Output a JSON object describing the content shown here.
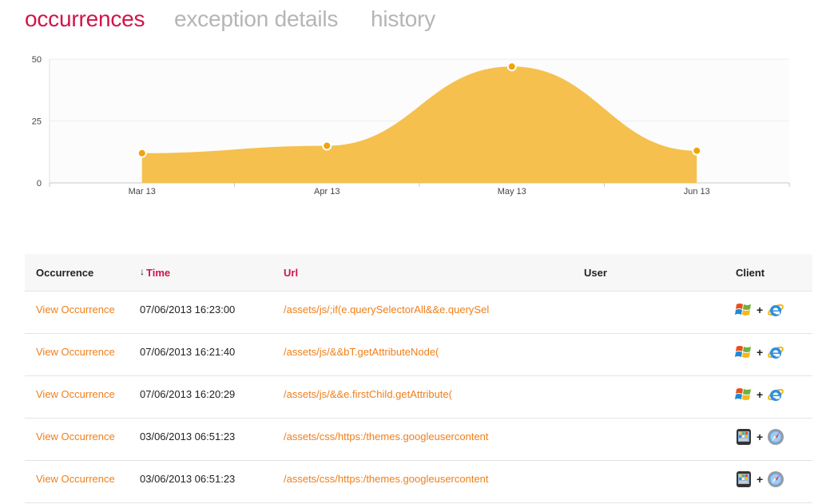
{
  "tabs": [
    {
      "label": "occurrences",
      "active": true
    },
    {
      "label": "exception details",
      "active": false
    },
    {
      "label": "history",
      "active": false
    }
  ],
  "chart_data": {
    "type": "area",
    "categories": [
      "Mar 13",
      "Apr 13",
      "May 13",
      "Jun 13"
    ],
    "values": [
      12,
      15,
      47,
      13
    ],
    "title": "",
    "xlabel": "",
    "ylabel": "",
    "ylim": [
      0,
      50
    ],
    "yticks": [
      0,
      25,
      50
    ],
    "grid": true,
    "fill_color": "#f5c04e",
    "point_color": "#f0a30a"
  },
  "table": {
    "headers": {
      "occurrence": "Occurrence",
      "time": "Time",
      "url": "Url",
      "user": "User",
      "client": "Client"
    },
    "sort_indicator": "↓",
    "plus": "+",
    "rows": [
      {
        "link": "View Occurrence",
        "time": "07/06/2013 16:23:00",
        "url": "/assets/js/;if(e.querySelectorAll&&e.querySel",
        "user": "",
        "os": "windows-icon",
        "browser": "internet-explorer-icon"
      },
      {
        "link": "View Occurrence",
        "time": "07/06/2013 16:21:40",
        "url": "/assets/js/&&bT.getAttributeNode(",
        "user": "",
        "os": "windows-icon",
        "browser": "internet-explorer-icon"
      },
      {
        "link": "View Occurrence",
        "time": "07/06/2013 16:20:29",
        "url": "/assets/js/&&e.firstChild.getAttribute(",
        "user": "",
        "os": "windows-icon",
        "browser": "internet-explorer-icon"
      },
      {
        "link": "View Occurrence",
        "time": "03/06/2013 06:51:23",
        "url": "/assets/css/https:/themes.googleusercontent",
        "user": "",
        "os": "iphone-icon",
        "browser": "safari-icon"
      },
      {
        "link": "View Occurrence",
        "time": "03/06/2013 06:51:23",
        "url": "/assets/css/https:/themes.googleusercontent",
        "user": "",
        "os": "iphone-icon",
        "browser": "safari-icon"
      }
    ]
  }
}
